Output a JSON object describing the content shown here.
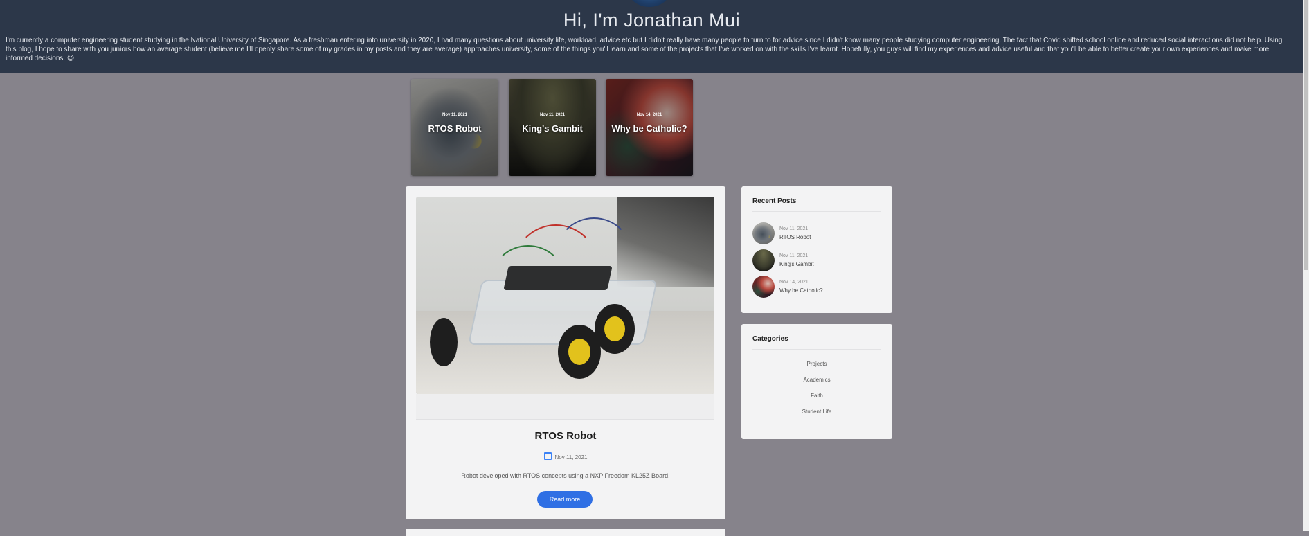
{
  "header": {
    "title": "Hi, I'm Jonathan Mui",
    "intro": "I'm currently a computer engineering student studying in the National University of Singapore. As a freshman entering into university in 2020, I had many questions about university life, workload, advice etc but I didn't really have many people to turn to for advice since I didn't know many people studying computer engineering. The fact that Covid shifted school online and reduced social interactions did not help. Using this blog, I hope to share with you juniors how an average student (believe me I'll openly share some of my grades in my posts and they are average) approaches university, some of the things you'll learn and some of the projects that I've worked on with the skills I've learnt. Hopefully, you guys will find my experiences and advice useful and that you'll be able to better create your own experiences and make more informed decisions. 😉"
  },
  "featured": [
    {
      "date": "Nov 11, 2021",
      "title": "RTOS Robot"
    },
    {
      "date": "Nov 11, 2021",
      "title": "King's Gambit"
    },
    {
      "date": "Nov 14, 2021",
      "title": "Why be Catholic?"
    }
  ],
  "post": {
    "title": "RTOS Robot",
    "date": "Nov 11, 2021",
    "description": "Robot developed with RTOS concepts using a NXP Freedom KL25Z Board.",
    "read_more": "Read more"
  },
  "recent_posts": {
    "title": "Recent Posts",
    "items": [
      {
        "date": "Nov 11, 2021",
        "title": "RTOS Robot"
      },
      {
        "date": "Nov 11, 2021",
        "title": "King's Gambit"
      },
      {
        "date": "Nov 14, 2021",
        "title": "Why be Catholic?"
      }
    ]
  },
  "categories": {
    "title": "Categories",
    "items": [
      "Projects",
      "Academics",
      "Faith",
      "Student Life"
    ]
  },
  "colors": {
    "header_bg": "#2c3749",
    "page_bg": "#86838b",
    "accent": "#2f6fe4"
  }
}
